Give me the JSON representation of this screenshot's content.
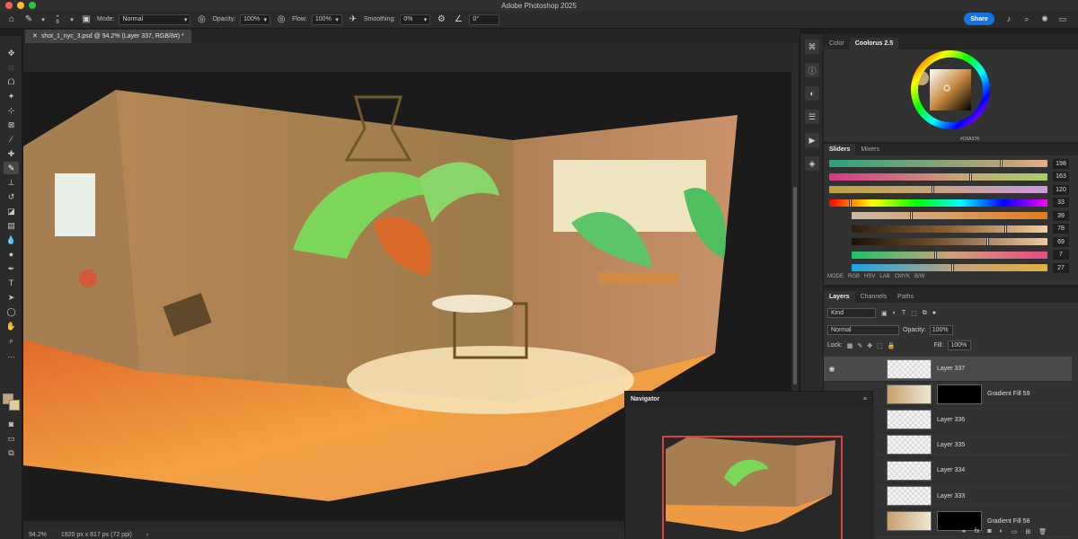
{
  "window": {
    "title": "Adobe Photoshop 2025"
  },
  "options": {
    "brush_size": "9",
    "mode_label": "Mode:",
    "mode_value": "Normal",
    "opacity_label": "Opacity:",
    "opacity_value": "100%",
    "flow_label": "Flow:",
    "flow_value": "100%",
    "smoothing_label": "Smoothing:",
    "smoothing_value": "0%",
    "angle_value": "0°",
    "share_label": "Share"
  },
  "document": {
    "tab_title": "shot_1_nyc_3.psd @ 94.2% (Layer 337, RGB/8#) *",
    "zoom": "94.2%",
    "dimensions": "1920 px x 817 px (72 ppi)"
  },
  "color_panel": {
    "tabs": [
      "Color",
      "Coolorus 2.5"
    ],
    "active_tab": "Coolorus 2.5",
    "hex": "#C6A378",
    "sub_tabs": [
      "Sliders",
      "Mixers"
    ],
    "sliders": [
      {
        "value": "198",
        "level": 0.78
      },
      {
        "value": "163",
        "level": 0.64
      },
      {
        "value": "120",
        "level": 0.47
      },
      {
        "value": "33",
        "level": 0.09
      },
      {
        "value": "39",
        "level": 0.3
      },
      {
        "value": "78",
        "level": 0.78
      },
      {
        "value": "69",
        "level": 0.69
      },
      {
        "value": "7",
        "level": 0.42
      },
      {
        "value": "27",
        "level": 0.51
      }
    ],
    "modes": [
      "MODE",
      "RGB",
      "HSV",
      "LAB",
      "CMYK",
      "B/W"
    ]
  },
  "layers_panel": {
    "tabs": [
      "Layers",
      "Channels",
      "Paths"
    ],
    "kind_label": "Kind",
    "blend_mode": "Normal",
    "opacity_label": "Opacity:",
    "opacity_value": "100%",
    "lock_label": "Lock:",
    "fill_label": "Fill:",
    "fill_value": "100%",
    "layers": [
      {
        "name": "Layer 337",
        "selected": true
      },
      {
        "name": "Gradient Fill 59",
        "selected": false
      },
      {
        "name": "Layer 336",
        "selected": false
      },
      {
        "name": "Layer 335",
        "selected": false
      },
      {
        "name": "Layer 334",
        "selected": false
      },
      {
        "name": "Layer 333",
        "selected": false
      },
      {
        "name": "Gradient Fill 58",
        "selected": false
      }
    ]
  },
  "navigator": {
    "title": "Navigator"
  },
  "colors": {
    "accent": "#1473e6",
    "foreground": "#c6a378",
    "background": "#e7c89a"
  }
}
